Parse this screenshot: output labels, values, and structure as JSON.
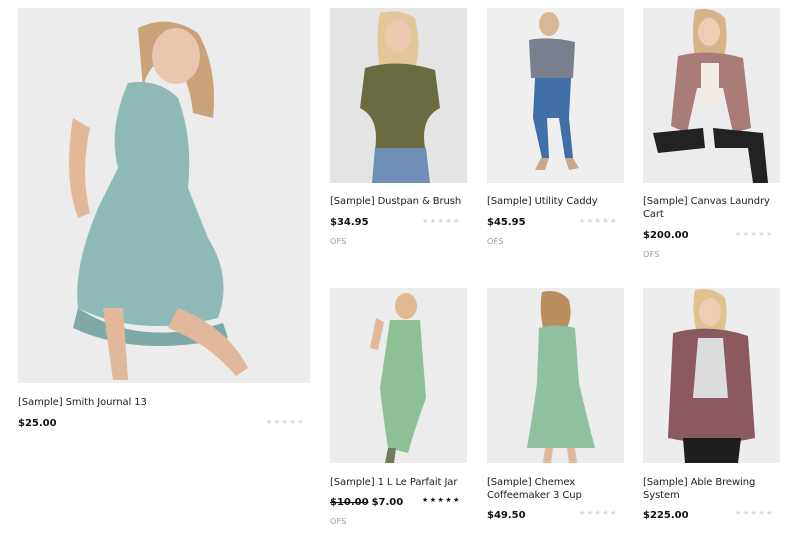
{
  "colors": {
    "background": "#ffffff",
    "image_bg": "#eeeeee",
    "star_empty": "#d8d8d8",
    "star_filled": "#111111",
    "badge": "#9a9a9a"
  },
  "products": [
    {
      "title": "[Sample] Smith Journal 13",
      "price": "$25.00",
      "rating": 0,
      "stars_text": "★★★★★",
      "badge": "",
      "image": "model-teal-dress"
    },
    {
      "title": "[Sample] Dustpan & Brush",
      "price": "$34.95",
      "rating": 0,
      "stars_text": "★★★★★",
      "badge": "OFS",
      "image": "model-olive-top"
    },
    {
      "title": "[Sample] Utility Caddy",
      "price": "$45.95",
      "rating": 0,
      "stars_text": "★★★★★",
      "badge": "OFS",
      "image": "model-offshoulder-jeans"
    },
    {
      "title_line1": "[Sample] Canvas Laundry",
      "title_line2": "Cart",
      "price": "$200.00",
      "rating": 0,
      "stars_text": "★★★★★",
      "badge": "OFS",
      "image": "model-striped-jacket"
    },
    {
      "title": "[Sample] 1 L Le Parfait Jar",
      "old_price": "$10.00",
      "price": "$7.00",
      "rating": 5,
      "stars_text": "★★★★★",
      "badge": "OFS",
      "image": "model-green-tunic"
    },
    {
      "title_line1": "[Sample] Chemex",
      "title_line2": "Coffeemaker 3 Cup",
      "price": "$49.50",
      "rating": 0,
      "stars_text": "★★★★★",
      "badge": "",
      "image": "model-green-dress"
    },
    {
      "title_line1": "[Sample] Able Brewing",
      "title_line2": "System",
      "price": "$225.00",
      "rating": 0,
      "stars_text": "★★★★★",
      "badge": "",
      "image": "model-plaid-wrap"
    }
  ]
}
